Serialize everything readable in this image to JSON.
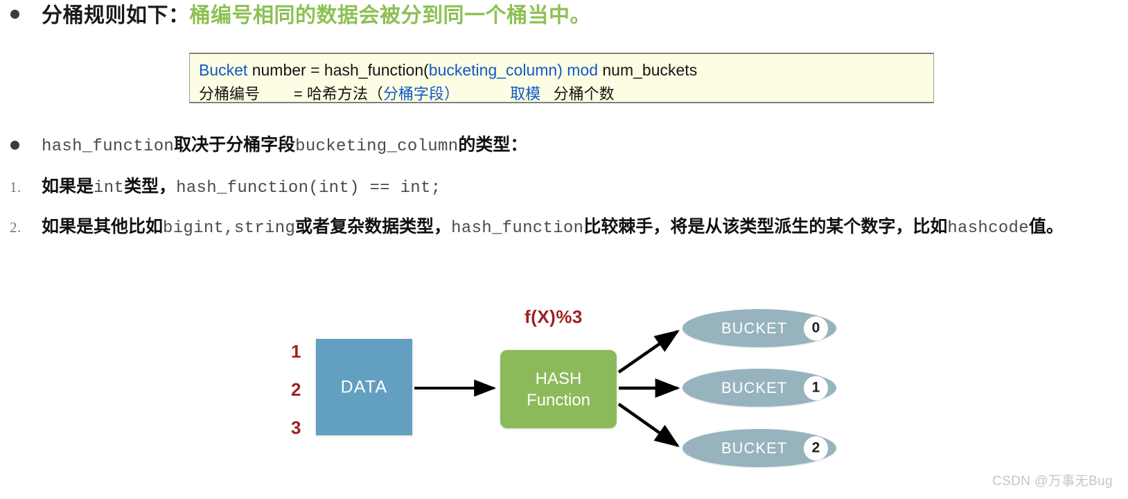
{
  "slide": {
    "bullet1": {
      "black_text": "分桶规则如下：",
      "green_text": "桶编号相同的数据会被分到同一个桶当中。",
      "green_color": "#8cc152"
    },
    "formula_box": {
      "background": "#fdfde3",
      "border_color": "#808080",
      "line1": [
        {
          "text": "Bucket",
          "color": "blue"
        },
        {
          "text": " number = hash_function(",
          "color": "black"
        },
        {
          "text": "bucketing_column)",
          "color": "blue"
        },
        {
          "text": "  ",
          "color": "black"
        },
        {
          "text": "mod",
          "color": "blue"
        },
        {
          "text": "   num_buckets",
          "color": "black"
        }
      ],
      "line2": [
        {
          "text": "分桶编号",
          "color": "black"
        },
        {
          "text": "        = 哈希方法（",
          "color": "black"
        },
        {
          "text": "分桶字段）",
          "color": "blue"
        },
        {
          "text": "            ",
          "color": "black"
        },
        {
          "text": "取模",
          "color": "blue"
        },
        {
          "text": "   分桶个数",
          "color": "black"
        }
      ]
    },
    "bullet2": {
      "parts": [
        {
          "text": "hash_function",
          "style": "mono"
        },
        {
          "text": "取决于分桶字段",
          "style": "cn"
        },
        {
          "text": "bucketing_column",
          "style": "mono"
        },
        {
          "text": "的类型：",
          "style": "cn"
        }
      ]
    },
    "numbered_items": [
      {
        "marker": "1.",
        "parts": [
          {
            "text": "如果是",
            "style": "cn"
          },
          {
            "text": "int",
            "style": "mono"
          },
          {
            "text": "类型，",
            "style": "cn"
          },
          {
            "text": "hash_function(int) == int;",
            "style": "mono"
          }
        ]
      },
      {
        "marker": "2.",
        "parts": [
          {
            "text": "如果是其他比如",
            "style": "cn"
          },
          {
            "text": "bigint,string",
            "style": "mono"
          },
          {
            "text": "或者复杂数据类型，",
            "style": "cn"
          },
          {
            "text": "hash_function",
            "style": "mono"
          },
          {
            "text": "比较棘手，将是从该类型派生的某个数字，比如",
            "style": "cn"
          },
          {
            "text": "hashcode",
            "style": "mono"
          },
          {
            "text": "值。",
            "style": "cn"
          }
        ]
      }
    ]
  },
  "diagram": {
    "data_box": {
      "label": "DATA",
      "color": "#629fc0"
    },
    "data_numbers": [
      "1",
      "2",
      "3"
    ],
    "hash_box": {
      "line1": "HASH",
      "line2": "Function",
      "color": "#8cba5a"
    },
    "modulo_label": {
      "text": "f(X)%3",
      "color": "#9e2121"
    },
    "buckets": [
      {
        "label": "BUCKET",
        "number": "0"
      },
      {
        "label": "BUCKET",
        "number": "1"
      },
      {
        "label": "BUCKET",
        "number": "2"
      }
    ],
    "bucket_color": "#97b4be",
    "arrow_color": "#000000"
  },
  "watermark": {
    "text": "CSDN @万事无Bug"
  }
}
